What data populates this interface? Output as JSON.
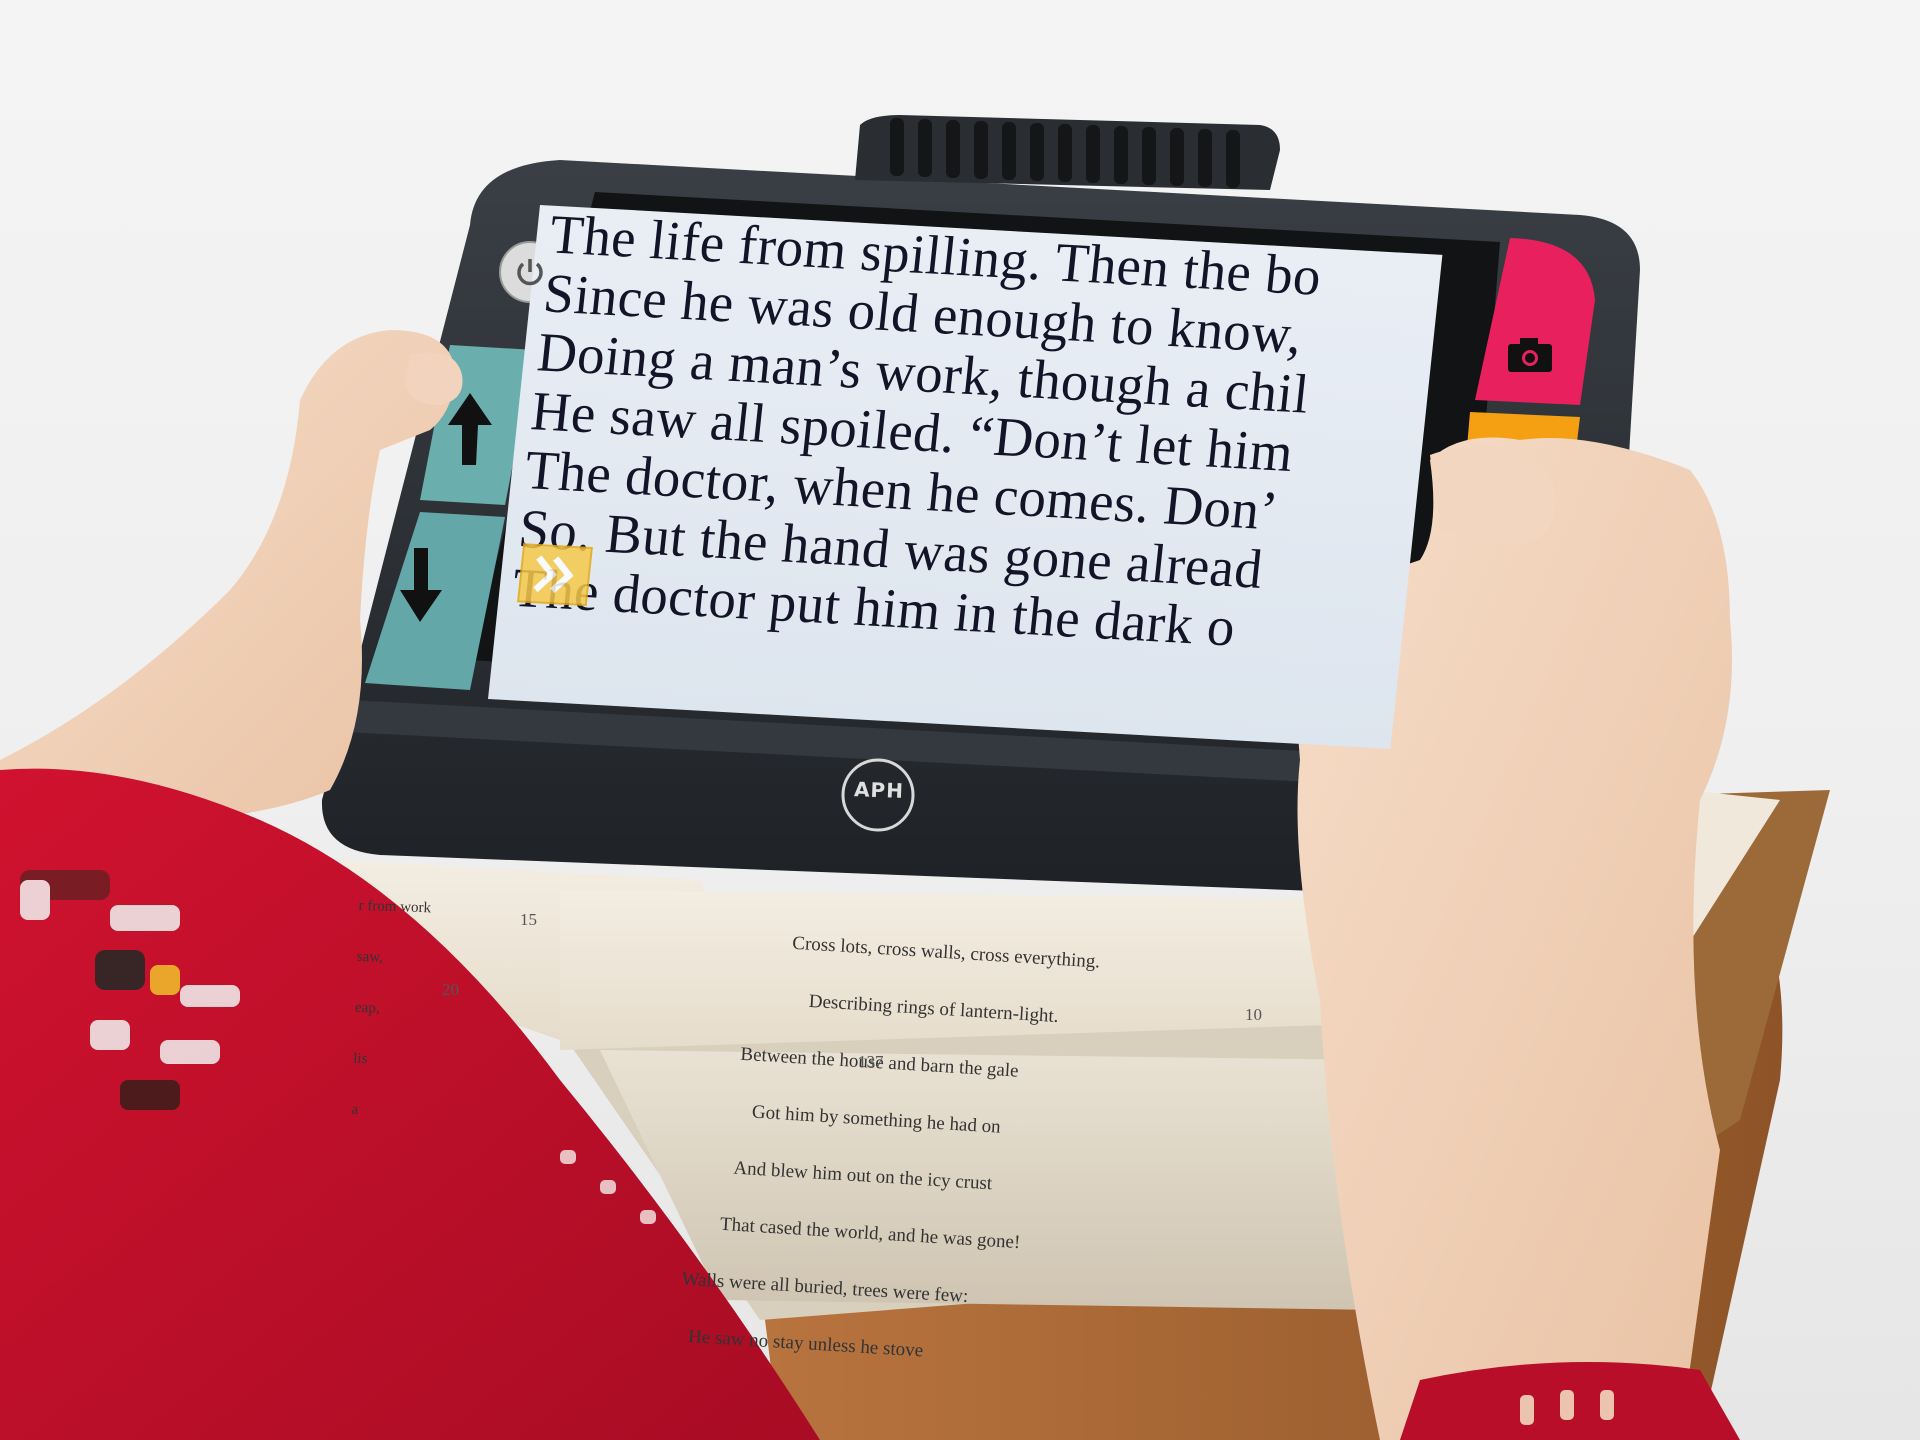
{
  "device": {
    "logo_text": "APH",
    "screen_lines": [
      "The life from spilling. Then the bo",
      "Since he was old enough to know,",
      "Doing a man’s work, though a chil",
      "He saw all spoiled. “Don’t let him",
      "The doctor, when he comes. Don’",
      "So. But the hand was gone alread",
      "The doctor put him in the dark o"
    ],
    "buttons": {
      "power_icon": "power-icon",
      "up_icon": "arrow-up-icon",
      "down_icon": "arrow-down-icon",
      "camera_icon": "camera-icon",
      "mode_icon": "double-chevron-icon"
    }
  },
  "book": {
    "left_page_lines": [
      "r from work",
      "saw,",
      "eap,",
      "lis",
      "a"
    ],
    "left_page_numbers": [
      "15",
      "20"
    ],
    "right_page_lines": [
      "Cross lots, cross walls, cross everything.",
      "Describing rings of lantern-light.",
      "Between the house and barn the gale",
      "Got him by something he had on",
      "And blew him out on the icy crust",
      "That cased the world, and he was gone!",
      "Walls were all buried, trees were few:",
      "He saw no stay unless he stove"
    ],
    "right_page_number": "10",
    "folio": "137"
  },
  "colors": {
    "teal_buttons": "#6aaeae",
    "pink_button": "#e8205e",
    "orange_button": "#f5a013",
    "sweater": "#c8102e",
    "device_body": "#2b2f34"
  }
}
